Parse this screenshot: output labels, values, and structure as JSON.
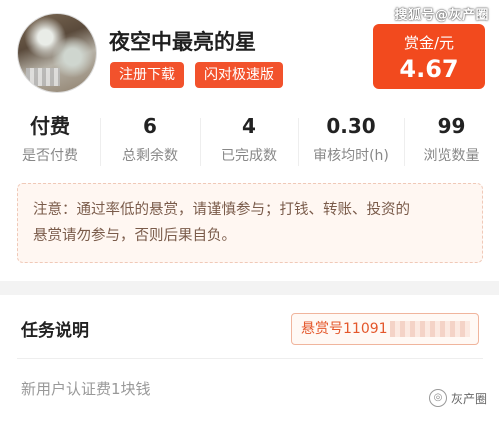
{
  "watermarks": {
    "top": "搜狐号@灰产圈",
    "bottom": "灰产圈"
  },
  "profile": {
    "name": "夜空中最亮的星",
    "tags": [
      "注册下载",
      "闪对极速版"
    ]
  },
  "reward": {
    "label": "赏金/元",
    "value": "4.67"
  },
  "stats": [
    {
      "value": "付费",
      "label": "是否付费"
    },
    {
      "value": "6",
      "label": "总剩余数"
    },
    {
      "value": "4",
      "label": "已完成数"
    },
    {
      "value": "0.30",
      "label": "审核均时(h)"
    },
    {
      "value": "99",
      "label": "浏览数量"
    }
  ],
  "notice": {
    "line1": "注意：通过率低的悬赏，请谨慎参与；打钱、转账、投资的",
    "line2": "悬赏请勿参与，否则后果自负。"
  },
  "task": {
    "section_title": "任务说明",
    "reward_no": "悬赏号11091",
    "description": "新用户认证费1块钱"
  }
}
